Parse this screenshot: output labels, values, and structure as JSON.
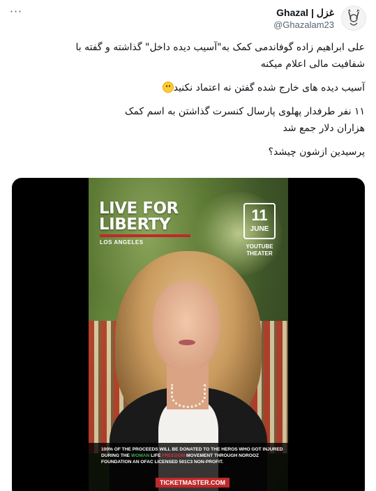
{
  "header": {
    "display_name": "Ghazal | غزل",
    "handle": "@Ghazalam23",
    "more_label": "···"
  },
  "tweet": {
    "paragraph1_line1": "علی ابراهیم زاده گوفاندمی کمک به\"آسیب دیده داخل\" گذاشته و گفته با",
    "paragraph1_line2": "شفافیت مالی اعلام میکنه",
    "paragraph2": "آسیب دیده های خارج شده گفتن نه اعتماد نکنید",
    "paragraph3_line1": "۱۱ نفر طرفدار پهلوی پارسال کنسرت گذاشتن به اسم کمک",
    "paragraph3_line2": "هزاران دلار جمع شد",
    "paragraph4": "پرسیدین ازشون چیشد؟"
  },
  "media": {
    "title": "LIVE FOR LIBERTY",
    "location": "LOS ANGELES",
    "date_day": "11",
    "date_month": "JUNE",
    "venue": "YOUTUBE THEATER",
    "proceeds_part1": "100% OF THE PROCEEDS WILL BE DONATED TO THE HEROS WHO GOT INJURED DURING THE",
    "proceeds_woman": "WOMAN",
    "proceeds_life": "LIFE",
    "proceeds_freedom": "FREEDOM",
    "proceeds_part2": "MOVEMENT THROUGH NOROOZ FOUNDATION AN OFAC LICENSED 501C3 NON-PROFIT.",
    "ticket_label": "TICKETMASTER.COM"
  },
  "icons": {
    "avatar": "avatar-illustration",
    "more": "more-horizontal-icon",
    "emoji": "smiling-face-emoji"
  }
}
